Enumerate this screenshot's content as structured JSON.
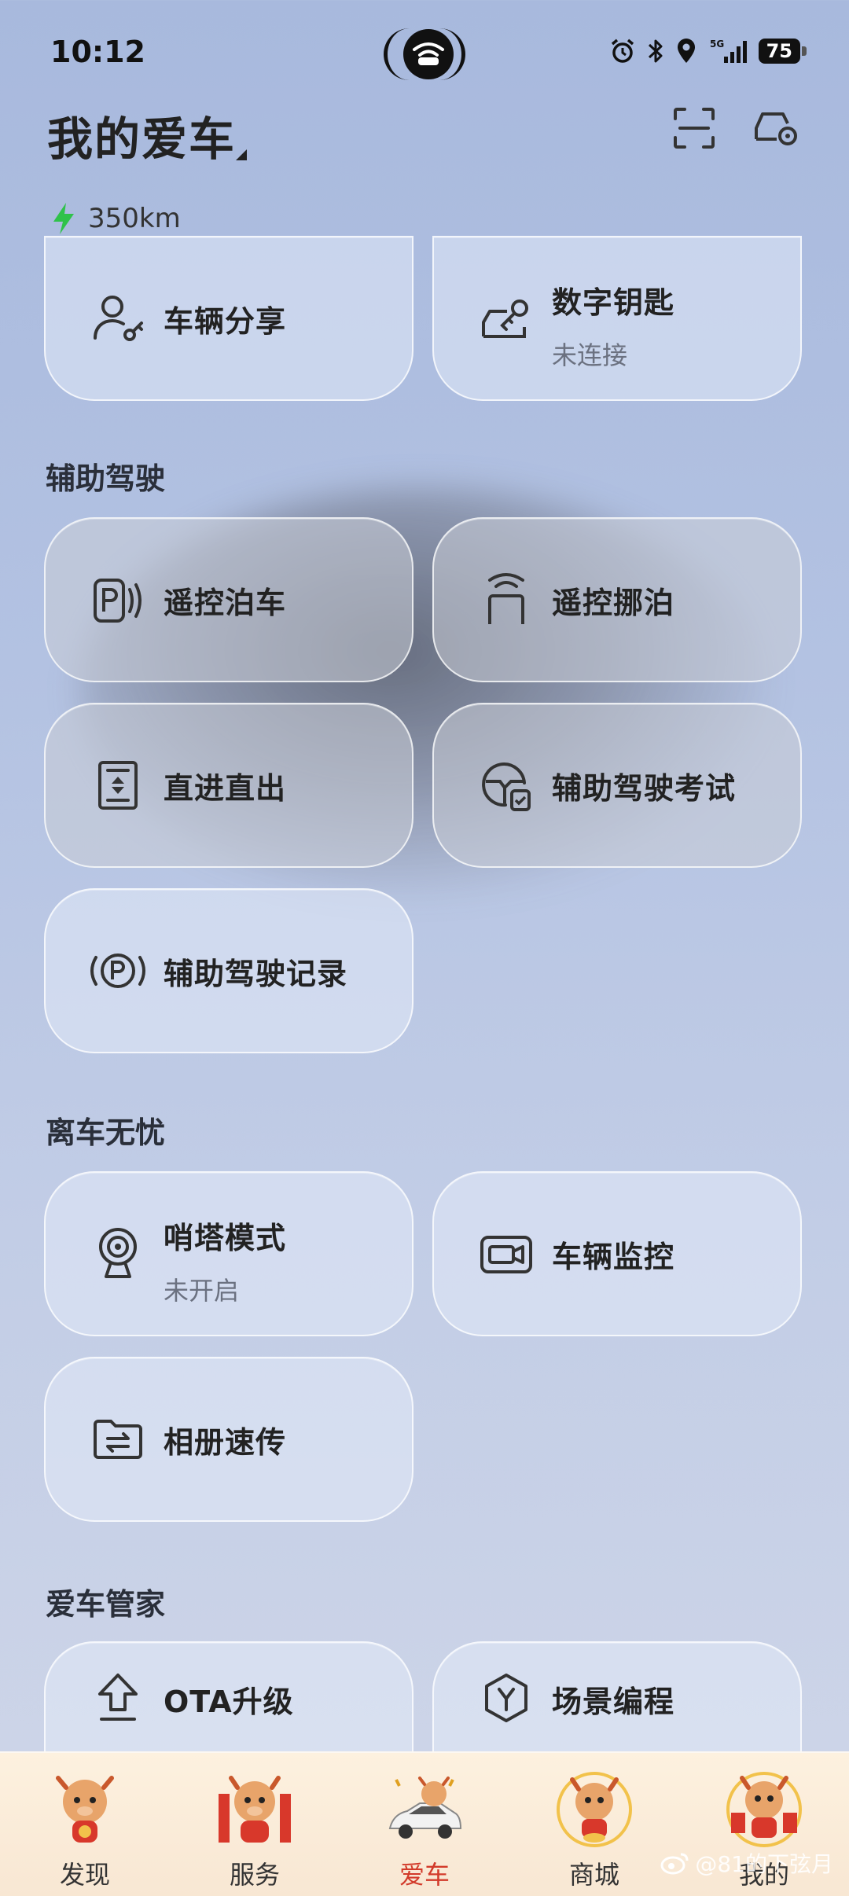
{
  "status": {
    "time": "10:12",
    "battery": "75",
    "network": "5G"
  },
  "header": {
    "title": "我的爱车",
    "range": "350km",
    "colors": {
      "accent_green": "#2fc24a",
      "active_red": "#d23a2a"
    }
  },
  "sections": [
    {
      "title": "",
      "cards": [
        {
          "label": "车辆分享",
          "sub": "",
          "icon": "user-key-icon"
        },
        {
          "label": "数字钥匙",
          "sub": "未连接",
          "icon": "car-key-icon"
        }
      ]
    },
    {
      "title": "辅助驾驶",
      "cards": [
        {
          "label": "遥控泊车",
          "sub": "",
          "icon": "remote-parking-icon"
        },
        {
          "label": "遥控挪泊",
          "sub": "",
          "icon": "remote-move-icon"
        },
        {
          "label": "直进直出",
          "sub": "",
          "icon": "straight-in-out-icon"
        },
        {
          "label": "辅助驾驶考试",
          "sub": "",
          "icon": "steering-check-icon"
        },
        {
          "label": "辅助驾驶记录",
          "sub": "",
          "icon": "parking-record-icon"
        }
      ]
    },
    {
      "title": "离车无忧",
      "cards": [
        {
          "label": "哨塔模式",
          "sub": "未开启",
          "icon": "sentry-icon"
        },
        {
          "label": "车辆监控",
          "sub": "",
          "icon": "camera-monitor-icon"
        },
        {
          "label": "相册速传",
          "sub": "",
          "icon": "folder-transfer-icon"
        }
      ]
    },
    {
      "title": "爱车管家",
      "cards": [
        {
          "label": "OTA升级",
          "sub": "",
          "icon": "upload-icon"
        },
        {
          "label": "场景编程",
          "sub": "",
          "icon": "hex-y-icon"
        }
      ]
    }
  ],
  "nav": [
    {
      "label": "发现",
      "icon": "mascot-lantern-icon",
      "active": false
    },
    {
      "label": "服务",
      "icon": "mascot-couplet-icon",
      "active": false
    },
    {
      "label": "爱车",
      "icon": "car-mascot-icon",
      "active": true
    },
    {
      "label": "商城",
      "icon": "mascot-gold-icon",
      "active": false
    },
    {
      "label": "我的",
      "icon": "mascot-envelope-icon",
      "active": false
    }
  ],
  "watermark": "@81的下弦月"
}
